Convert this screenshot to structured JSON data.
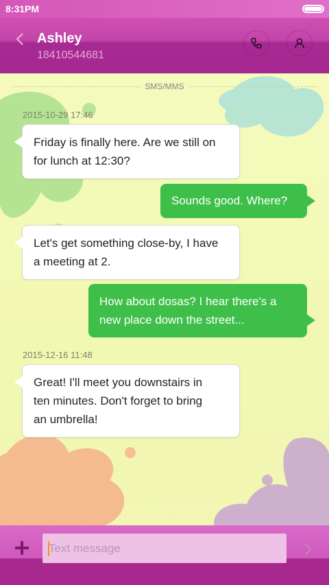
{
  "status_bar": {
    "time": "8:31PM"
  },
  "header": {
    "contact_name": "Ashley",
    "contact_number": "18410544681"
  },
  "thread": {
    "separator_label": "SMS/MMS",
    "messages": [
      {
        "timestamp": "2015-10-29 17:46",
        "direction": "incoming",
        "lines": [
          "Friday is finally here. Are we still on",
          "for lunch at 12:30?"
        ]
      },
      {
        "direction": "outgoing",
        "lines": [
          "Sounds good. Where?"
        ]
      },
      {
        "direction": "incoming",
        "lines": [
          "Let's get something close-by, I have",
          "a meeting at 2."
        ]
      },
      {
        "direction": "outgoing",
        "lines": [
          "How about dosas? I hear there's a",
          "new place down the street..."
        ]
      },
      {
        "timestamp": "2015-12-16 11:48",
        "direction": "incoming",
        "lines": [
          "Great! I'll meet you downstairs in",
          "ten minutes. Don't forget to bring",
          "an umbrella!"
        ]
      }
    ]
  },
  "composer": {
    "placeholder": "Text message"
  },
  "icons": {
    "back": "chevron-left-icon",
    "call": "phone-icon",
    "contact": "person-icon",
    "attach": "plus-icon",
    "send": "chevron-right-icon"
  },
  "colors": {
    "header": "#a52790",
    "incoming_bubble": "#ffffff",
    "outgoing_bubble": "#3ebf4a",
    "background": "#f1f8b2"
  }
}
